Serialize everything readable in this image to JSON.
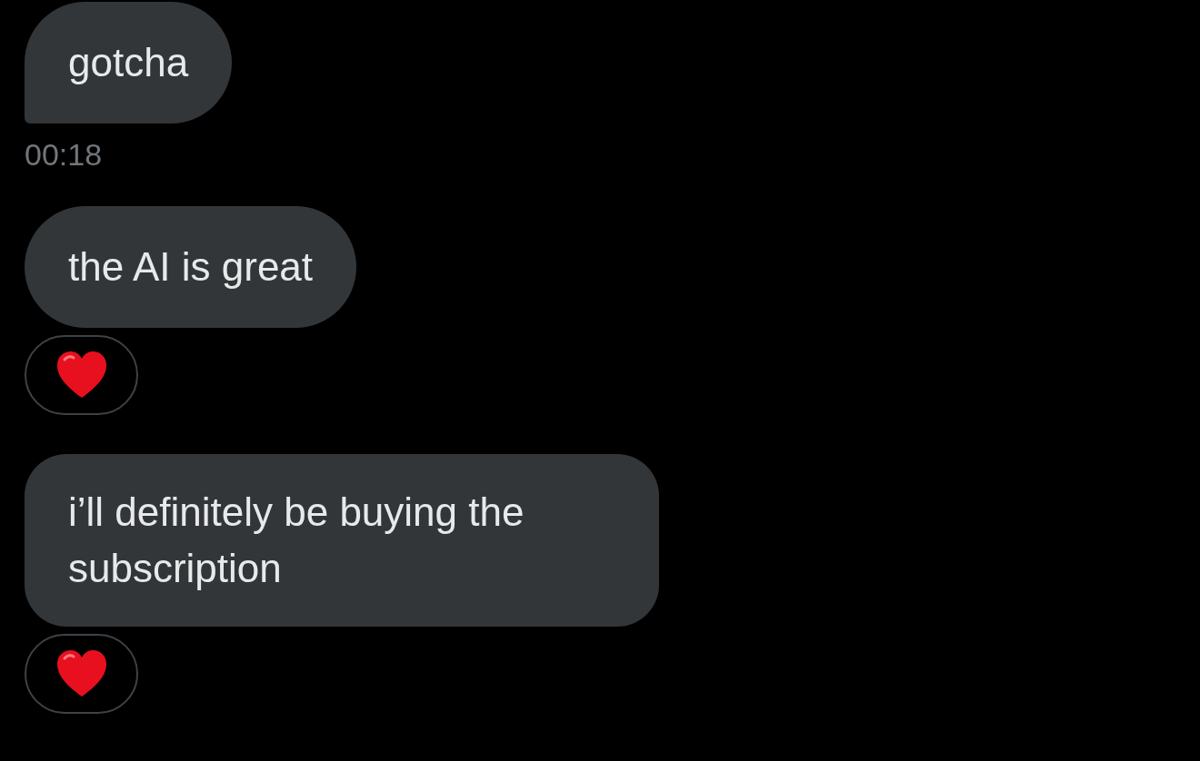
{
  "messages": [
    {
      "text": "gotcha",
      "tail": true,
      "time": "00:18"
    },
    {
      "text": "the AI is great",
      "tail": false,
      "reactions": [
        {
          "kind": "heart"
        }
      ]
    },
    {
      "text": "i’ll definitely be buying the subscription",
      "tail": false,
      "reactions": [
        {
          "kind": "heart"
        }
      ]
    }
  ]
}
